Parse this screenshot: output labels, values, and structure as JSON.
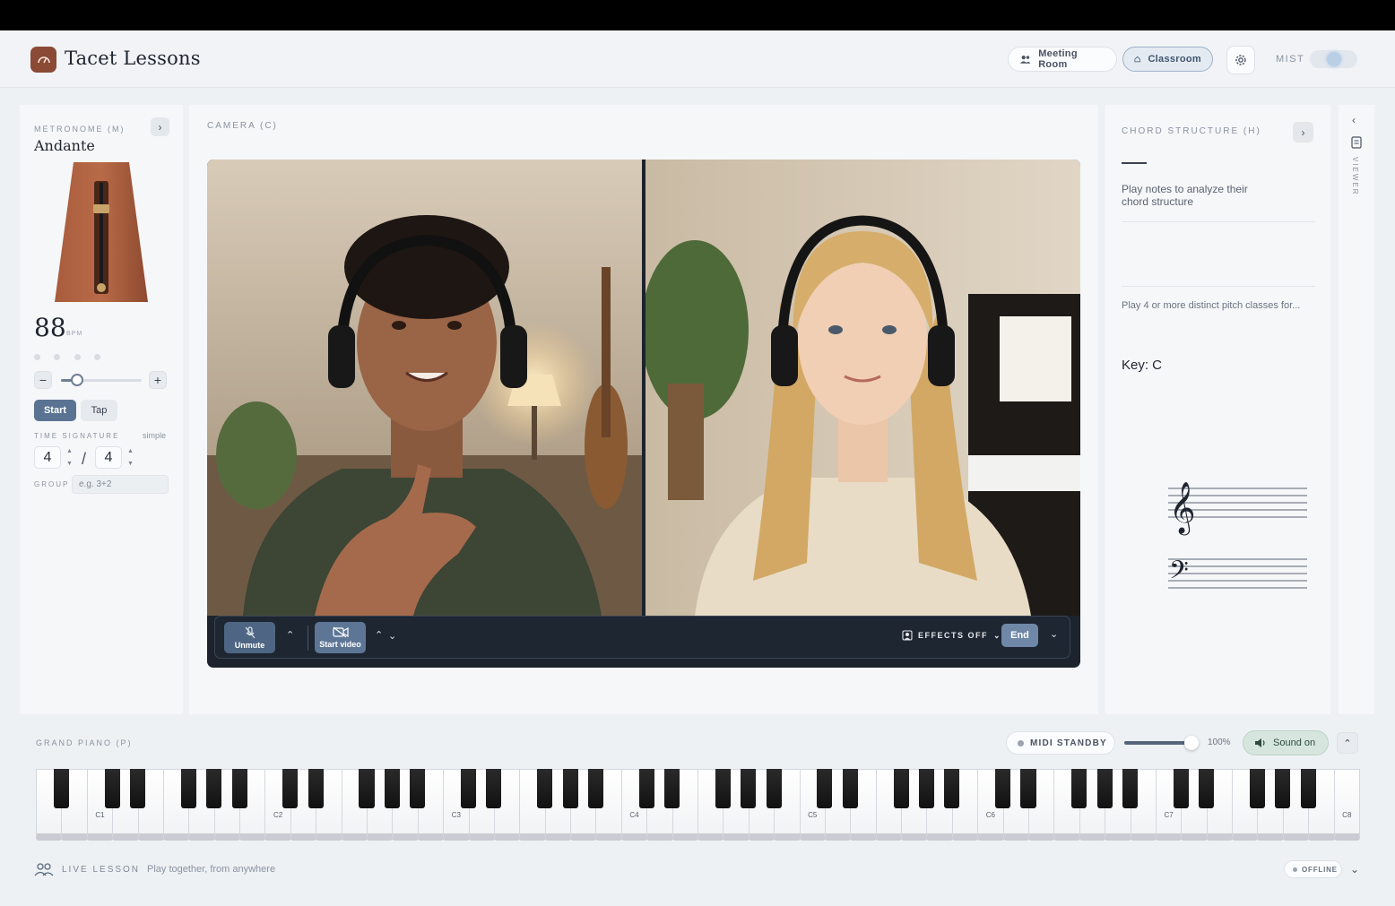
{
  "app": {
    "title": "Tacet Lessons",
    "brand_color": "#8a4a35",
    "accent_color": "#5a7393"
  },
  "header": {
    "meeting_room": "Meeting Room",
    "classroom": "Classroom",
    "mist_label": "MIST",
    "mist_on": true
  },
  "metronome": {
    "label": "METRONOME (M)",
    "tempo_name": "Andante",
    "bpm": "88",
    "bpm_unit": "BPM",
    "bpm_slider_fraction": 0.2,
    "minus": "−",
    "plus": "+",
    "start": "Start",
    "tap": "Tap",
    "time_signature_label": "TIME SIGNATURE",
    "time_signature_type": "simple",
    "numerator": "4",
    "denominator": "4",
    "slash": "/",
    "group_label": "GROUP",
    "group_placeholder": "e.g. 3+2"
  },
  "camera": {
    "label": "CAMERA (C)",
    "unmute": "Unmute",
    "start_video": "Start video",
    "effects": "EFFECTS OFF",
    "end": "End"
  },
  "chord": {
    "label": "CHORD STRUCTURE (H)",
    "hint": "Play notes to analyze their chord structure",
    "hint2": "Play 4 or more distinct pitch classes for...",
    "key": "Key: C"
  },
  "viewer": {
    "label": "VIEWER"
  },
  "piano": {
    "label": "GRAND PIANO (P)",
    "midi": "MIDI STANDBY",
    "volume": "100%",
    "volume_fraction": 0.9,
    "sound": "Sound on",
    "octave_labels": [
      "C1",
      "C2",
      "C3",
      "C4",
      "C5",
      "C6",
      "C7",
      "C8"
    ]
  },
  "footer": {
    "label": "LIVE LESSON",
    "subtitle": "Play together, from anywhere",
    "status": "OFFLINE"
  }
}
